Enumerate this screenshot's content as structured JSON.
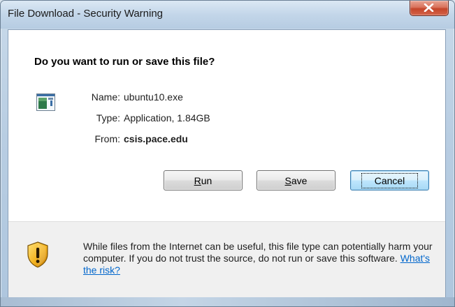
{
  "window": {
    "title": "File Download - Security Warning",
    "close_symbol": "X"
  },
  "dialog": {
    "question": "Do you want to run or save this file?",
    "file_icon": "application-icon",
    "fields": {
      "name_label": "Name:",
      "name_value": "ubuntu10.exe",
      "type_label": "Type:",
      "type_value": "Application, 1.84GB",
      "from_label": "From:",
      "from_value": "csis.pace.edu"
    },
    "buttons": {
      "run_accel": "R",
      "run_rest": "un",
      "save_accel": "S",
      "save_rest": "ave",
      "cancel_label": "Cancel"
    }
  },
  "warning": {
    "icon": "shield-warning-icon",
    "text": "While files from the Internet can be useful, this file type can potentially harm your computer. If you do not trust the source, do not run or save this software.",
    "link_text": "What's the risk?"
  },
  "colors": {
    "link": "#0066cc",
    "close_button": "#c4452a",
    "shield": "#e8a317"
  }
}
